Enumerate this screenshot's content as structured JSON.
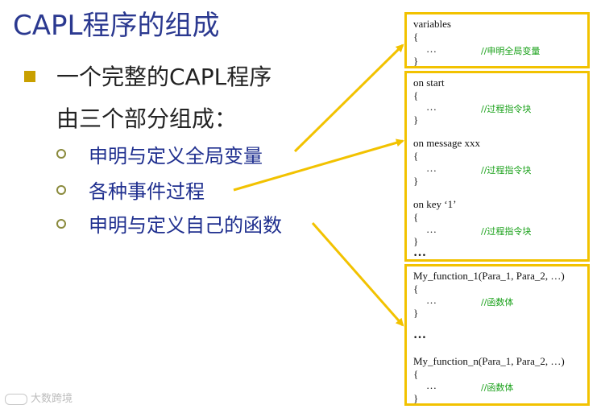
{
  "slide": {
    "title": "CAPL程序的组成",
    "main_line1": "一个完整的CAPL程序",
    "main_line2": "由三个部分组成：",
    "sub_items": [
      "申明与定义全局变量",
      "各种事件过程",
      "申明与定义自己的函数"
    ]
  },
  "boxes": {
    "variables": {
      "head": "variables",
      "open": "{",
      "dots": "…",
      "comment": "//申明全局变量",
      "close": "}"
    },
    "events": {
      "start_head": "on start",
      "start_open": "{",
      "start_dots": "…",
      "start_comment": "//过程指令块",
      "start_close": "}",
      "msg_head": "on message xxx",
      "msg_open": "{",
      "msg_dots": "…",
      "msg_comment": "//过程指令块",
      "msg_close": "}",
      "key_head": "on key ‘1’",
      "key_open": "{",
      "key_dots": "…",
      "key_comment": "//过程指令块",
      "key_close": "}",
      "ellipsis": "…"
    },
    "functions": {
      "f1_head": "My_function_1(Para_1, Para_2, …)",
      "f1_open": "{",
      "f1_dots": "…",
      "f1_comment": "//函数体",
      "f1_close": "}",
      "ellipsis": "…",
      "fn_head": "My_function_n(Para_1, Para_2, …)",
      "fn_open": "{",
      "fn_dots": "…",
      "fn_comment": "//函数体",
      "fn_close": "}"
    }
  },
  "watermark": {
    "text": "大数跨境"
  },
  "colors": {
    "title": "#2b3990",
    "accent_yellow": "#f2c200",
    "bullet": "#c9a000",
    "sub_text": "#1f2f8f",
    "comment": "#1aa11a"
  }
}
